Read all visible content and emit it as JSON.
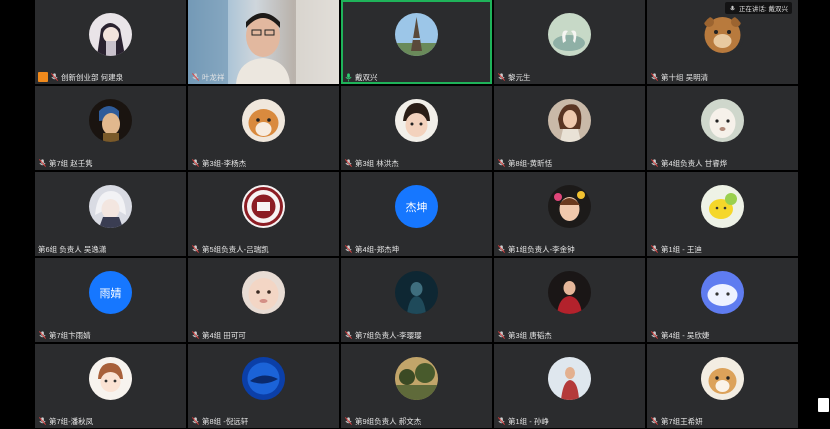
{
  "speaking_indicator": {
    "label": "正在讲话: 戴双兴"
  },
  "participants": [
    {
      "name": "创新创业部 何建泉",
      "avatar": "anime-girl",
      "host": true
    },
    {
      "name": "叶龙祥",
      "avatar": "video"
    },
    {
      "name": "戴双兴",
      "avatar": "eiffel-tower",
      "active": true,
      "mic_active": true
    },
    {
      "name": "黎元生",
      "avatar": "swans"
    },
    {
      "name": "第十组 吴明清",
      "avatar": "bear-cartoon"
    },
    {
      "name": "第7组 赵壬隽",
      "avatar": "girl-pearl-earring"
    },
    {
      "name": "第3组-李杨杰",
      "avatar": "shiba-dog"
    },
    {
      "name": "第3组 林洪杰",
      "avatar": "child"
    },
    {
      "name": "第8组-黄昕恬",
      "avatar": "girl-fashion"
    },
    {
      "name": "第4组负责人 甘睿烨",
      "avatar": "alpaca"
    },
    {
      "name": "第6组 负责人 吴逸潇",
      "avatar": "anime-boy"
    },
    {
      "name": "第5组负责人-吕瑞凯",
      "avatar": "school-seal"
    },
    {
      "name": "第4组-郑杰坤",
      "avatar_text": "杰坤"
    },
    {
      "name": "第1组负责人-李金钟",
      "avatar": "kid-flowers"
    },
    {
      "name": "第1组 - 王迪",
      "avatar": "lemon"
    },
    {
      "name": "第7组卞雨婧",
      "avatar_text": "雨婧"
    },
    {
      "name": "第4组 田可可",
      "avatar": "baby-face"
    },
    {
      "name": "第7组负责人-李璎璎",
      "avatar": "dark-photo"
    },
    {
      "name": "第3组 唐韬杰",
      "avatar": "red-shirt"
    },
    {
      "name": "第4组 - 吴欣婕",
      "avatar": "cloud-cartoon"
    },
    {
      "name": "第7组-潘秋凤",
      "avatar": "cartoon-girl"
    },
    {
      "name": "第8组 -倪远轩",
      "avatar": "blue-orb"
    },
    {
      "name": "第9组负责人 郝文杰",
      "avatar": "landscape"
    },
    {
      "name": "第1组 - 孙峥",
      "avatar": "photo-person"
    },
    {
      "name": "第7组王希妍",
      "avatar": "corgi"
    }
  ]
}
